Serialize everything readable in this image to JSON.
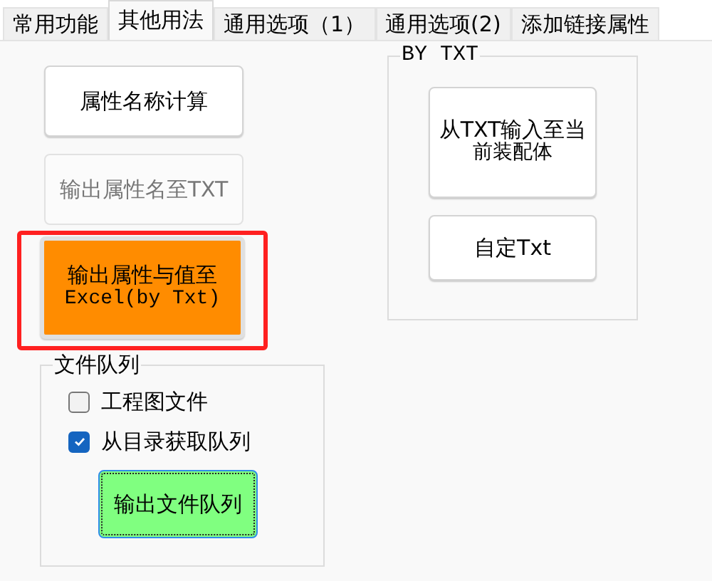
{
  "tabs": [
    {
      "label": "常用功能",
      "selected": false
    },
    {
      "label": "其他用法",
      "selected": true
    },
    {
      "label": "通用选项（1）",
      "selected": false
    },
    {
      "label": "通用选项(2)",
      "selected": false
    },
    {
      "label": "添加链接属性",
      "selected": false
    }
  ],
  "left_buttons": [
    {
      "label": "属性名称计算",
      "disabled": false,
      "highlighted": false
    },
    {
      "label": "输出属性名至TXT",
      "disabled": true,
      "highlighted": false
    },
    {
      "label": "输出属性与值至",
      "label_line_2": "Excel(by Txt)",
      "disabled": false,
      "highlighted": true,
      "color": "#ff8c00"
    }
  ],
  "file_queue": {
    "title": "文件队列",
    "checkboxes": [
      {
        "label": "工程图文件",
        "checked": false
      },
      {
        "label": "从目录获取队列",
        "checked": true
      }
    ],
    "button": {
      "label": "输出文件队列",
      "color": "#80ff80",
      "focused": true
    }
  },
  "by_txt": {
    "title": "BY TXT",
    "buttons": [
      {
        "label": "从TXT输入至当",
        "label_line_2": "前装配体"
      },
      {
        "label": "自定Txt"
      }
    ]
  }
}
